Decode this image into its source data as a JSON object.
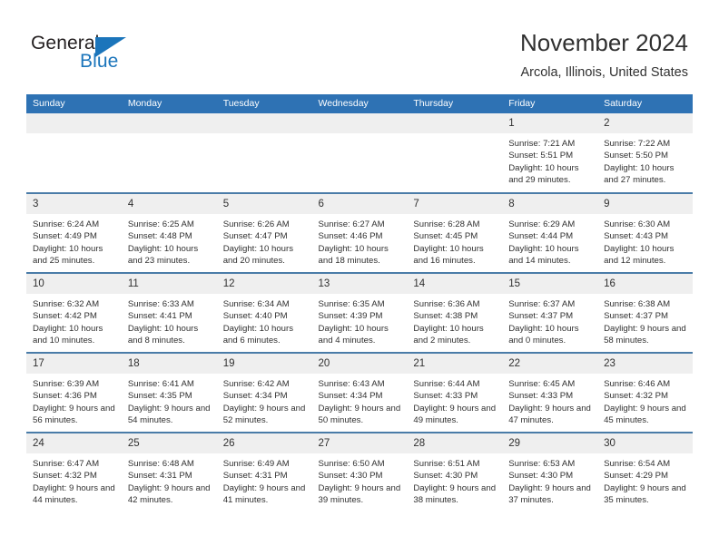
{
  "brand": {
    "name_part1": "General",
    "name_part2": "Blue"
  },
  "header": {
    "title": "November 2024",
    "subtitle": "Arcola, Illinois, United States"
  },
  "colors": {
    "header_blue": "#2e72b4",
    "daynum_band": "#efefef",
    "row_divider": "#4a7ca8",
    "brand_blue": "#1b75bb",
    "text": "#303030"
  },
  "weekdays": [
    "Sunday",
    "Monday",
    "Tuesday",
    "Wednesday",
    "Thursday",
    "Friday",
    "Saturday"
  ],
  "labels": {
    "sunrise": "Sunrise:",
    "sunset": "Sunset:",
    "daylight": "Daylight:"
  },
  "weeks": [
    [
      {
        "day": "",
        "empty": true
      },
      {
        "day": "",
        "empty": true
      },
      {
        "day": "",
        "empty": true
      },
      {
        "day": "",
        "empty": true
      },
      {
        "day": "",
        "empty": true
      },
      {
        "day": "1",
        "sunrise": "Sunrise: 7:21 AM",
        "sunset": "Sunset: 5:51 PM",
        "daylight": "Daylight: 10 hours and 29 minutes."
      },
      {
        "day": "2",
        "sunrise": "Sunrise: 7:22 AM",
        "sunset": "Sunset: 5:50 PM",
        "daylight": "Daylight: 10 hours and 27 minutes."
      }
    ],
    [
      {
        "day": "3",
        "sunrise": "Sunrise: 6:24 AM",
        "sunset": "Sunset: 4:49 PM",
        "daylight": "Daylight: 10 hours and 25 minutes."
      },
      {
        "day": "4",
        "sunrise": "Sunrise: 6:25 AM",
        "sunset": "Sunset: 4:48 PM",
        "daylight": "Daylight: 10 hours and 23 minutes."
      },
      {
        "day": "5",
        "sunrise": "Sunrise: 6:26 AM",
        "sunset": "Sunset: 4:47 PM",
        "daylight": "Daylight: 10 hours and 20 minutes."
      },
      {
        "day": "6",
        "sunrise": "Sunrise: 6:27 AM",
        "sunset": "Sunset: 4:46 PM",
        "daylight": "Daylight: 10 hours and 18 minutes."
      },
      {
        "day": "7",
        "sunrise": "Sunrise: 6:28 AM",
        "sunset": "Sunset: 4:45 PM",
        "daylight": "Daylight: 10 hours and 16 minutes."
      },
      {
        "day": "8",
        "sunrise": "Sunrise: 6:29 AM",
        "sunset": "Sunset: 4:44 PM",
        "daylight": "Daylight: 10 hours and 14 minutes."
      },
      {
        "day": "9",
        "sunrise": "Sunrise: 6:30 AM",
        "sunset": "Sunset: 4:43 PM",
        "daylight": "Daylight: 10 hours and 12 minutes."
      }
    ],
    [
      {
        "day": "10",
        "sunrise": "Sunrise: 6:32 AM",
        "sunset": "Sunset: 4:42 PM",
        "daylight": "Daylight: 10 hours and 10 minutes."
      },
      {
        "day": "11",
        "sunrise": "Sunrise: 6:33 AM",
        "sunset": "Sunset: 4:41 PM",
        "daylight": "Daylight: 10 hours and 8 minutes."
      },
      {
        "day": "12",
        "sunrise": "Sunrise: 6:34 AM",
        "sunset": "Sunset: 4:40 PM",
        "daylight": "Daylight: 10 hours and 6 minutes."
      },
      {
        "day": "13",
        "sunrise": "Sunrise: 6:35 AM",
        "sunset": "Sunset: 4:39 PM",
        "daylight": "Daylight: 10 hours and 4 minutes."
      },
      {
        "day": "14",
        "sunrise": "Sunrise: 6:36 AM",
        "sunset": "Sunset: 4:38 PM",
        "daylight": "Daylight: 10 hours and 2 minutes."
      },
      {
        "day": "15",
        "sunrise": "Sunrise: 6:37 AM",
        "sunset": "Sunset: 4:37 PM",
        "daylight": "Daylight: 10 hours and 0 minutes."
      },
      {
        "day": "16",
        "sunrise": "Sunrise: 6:38 AM",
        "sunset": "Sunset: 4:37 PM",
        "daylight": "Daylight: 9 hours and 58 minutes."
      }
    ],
    [
      {
        "day": "17",
        "sunrise": "Sunrise: 6:39 AM",
        "sunset": "Sunset: 4:36 PM",
        "daylight": "Daylight: 9 hours and 56 minutes."
      },
      {
        "day": "18",
        "sunrise": "Sunrise: 6:41 AM",
        "sunset": "Sunset: 4:35 PM",
        "daylight": "Daylight: 9 hours and 54 minutes."
      },
      {
        "day": "19",
        "sunrise": "Sunrise: 6:42 AM",
        "sunset": "Sunset: 4:34 PM",
        "daylight": "Daylight: 9 hours and 52 minutes."
      },
      {
        "day": "20",
        "sunrise": "Sunrise: 6:43 AM",
        "sunset": "Sunset: 4:34 PM",
        "daylight": "Daylight: 9 hours and 50 minutes."
      },
      {
        "day": "21",
        "sunrise": "Sunrise: 6:44 AM",
        "sunset": "Sunset: 4:33 PM",
        "daylight": "Daylight: 9 hours and 49 minutes."
      },
      {
        "day": "22",
        "sunrise": "Sunrise: 6:45 AM",
        "sunset": "Sunset: 4:33 PM",
        "daylight": "Daylight: 9 hours and 47 minutes."
      },
      {
        "day": "23",
        "sunrise": "Sunrise: 6:46 AM",
        "sunset": "Sunset: 4:32 PM",
        "daylight": "Daylight: 9 hours and 45 minutes."
      }
    ],
    [
      {
        "day": "24",
        "sunrise": "Sunrise: 6:47 AM",
        "sunset": "Sunset: 4:32 PM",
        "daylight": "Daylight: 9 hours and 44 minutes."
      },
      {
        "day": "25",
        "sunrise": "Sunrise: 6:48 AM",
        "sunset": "Sunset: 4:31 PM",
        "daylight": "Daylight: 9 hours and 42 minutes."
      },
      {
        "day": "26",
        "sunrise": "Sunrise: 6:49 AM",
        "sunset": "Sunset: 4:31 PM",
        "daylight": "Daylight: 9 hours and 41 minutes."
      },
      {
        "day": "27",
        "sunrise": "Sunrise: 6:50 AM",
        "sunset": "Sunset: 4:30 PM",
        "daylight": "Daylight: 9 hours and 39 minutes."
      },
      {
        "day": "28",
        "sunrise": "Sunrise: 6:51 AM",
        "sunset": "Sunset: 4:30 PM",
        "daylight": "Daylight: 9 hours and 38 minutes."
      },
      {
        "day": "29",
        "sunrise": "Sunrise: 6:53 AM",
        "sunset": "Sunset: 4:30 PM",
        "daylight": "Daylight: 9 hours and 37 minutes."
      },
      {
        "day": "30",
        "sunrise": "Sunrise: 6:54 AM",
        "sunset": "Sunset: 4:29 PM",
        "daylight": "Daylight: 9 hours and 35 minutes."
      }
    ]
  ]
}
